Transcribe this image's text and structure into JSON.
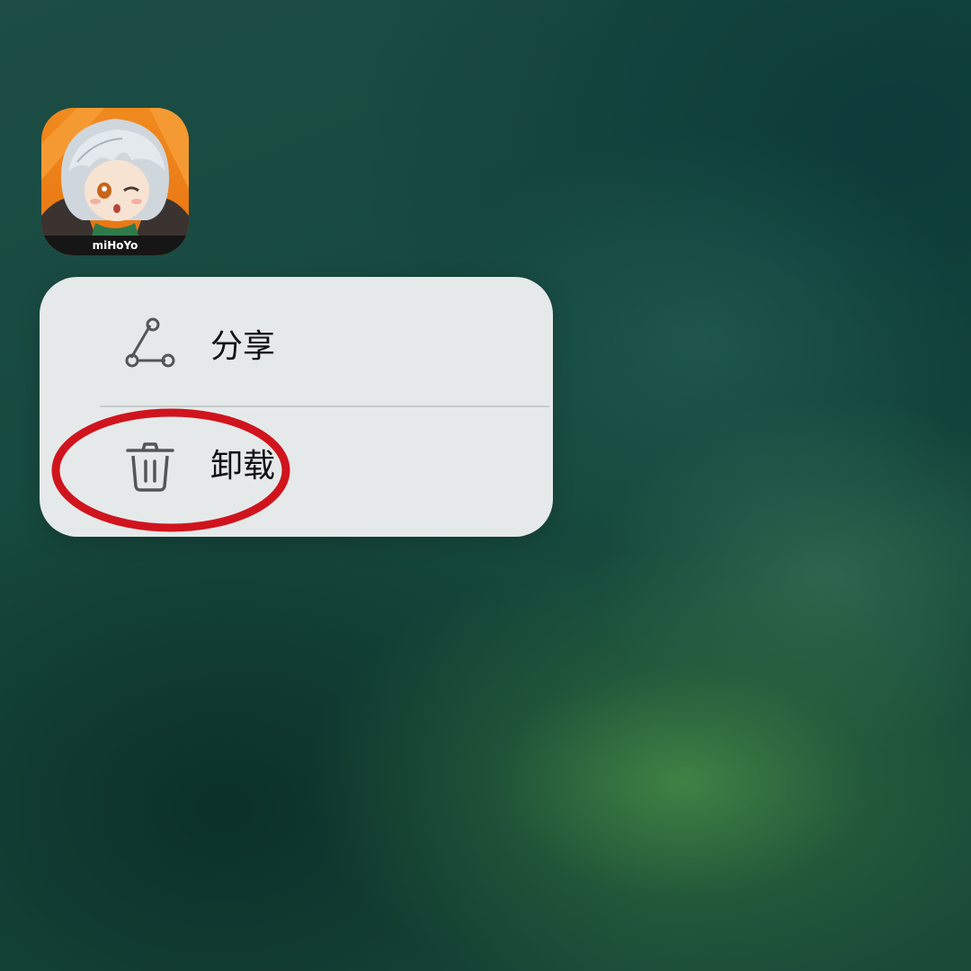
{
  "app": {
    "icon_name": "mihoyo-app-icon",
    "brand_text": "miHoYo"
  },
  "menu": {
    "items": [
      {
        "label": "分享",
        "icon": "share-icon"
      },
      {
        "label": "卸载",
        "icon": "trash-icon"
      }
    ]
  },
  "annotation": {
    "type": "red ellipse highlighting uninstall option",
    "color": "#d0141e"
  },
  "colors": {
    "menu_background": "#e6e9e9",
    "icon_stroke": "#555555",
    "icon_orange": "#f08a1e"
  }
}
